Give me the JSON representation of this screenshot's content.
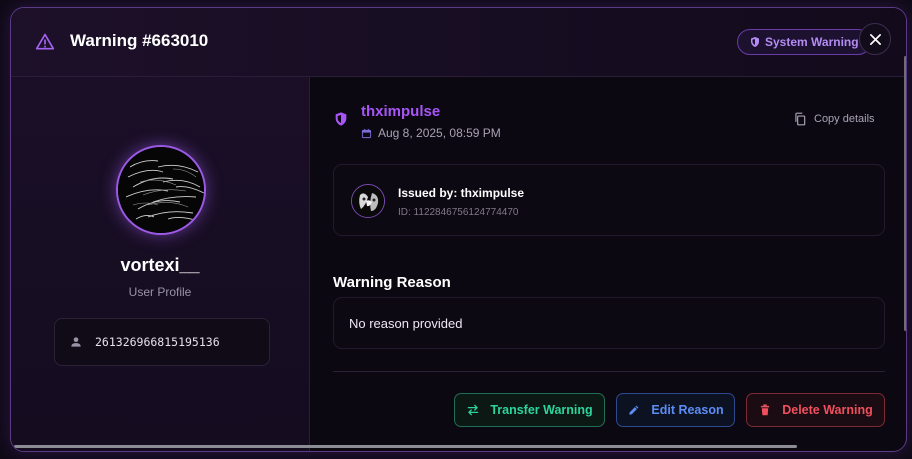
{
  "header": {
    "title": "Warning #663010",
    "badge": "System Warning",
    "warn_icon": "warning-triangle-icon",
    "close_icon": "close-icon"
  },
  "profile": {
    "username": "vortexi__",
    "subtitle": "User Profile",
    "user_id": "261326966815195136"
  },
  "warning": {
    "issuer": "thximpulse",
    "date": "Aug 8, 2025, 08:59 PM",
    "copy_label": "Copy details",
    "issued_by": "Issued by: thximpulse",
    "issuer_id": "ID: 1122846756124774470",
    "reason_title": "Warning Reason",
    "reason_text": "No reason provided"
  },
  "actions": {
    "transfer": "Transfer Warning",
    "edit": "Edit Reason",
    "delete": "Delete Warning"
  },
  "colors": {
    "accent": "#a855f7",
    "transfer": "#2dd49c",
    "edit": "#5b8ef5",
    "delete": "#f0505e"
  }
}
